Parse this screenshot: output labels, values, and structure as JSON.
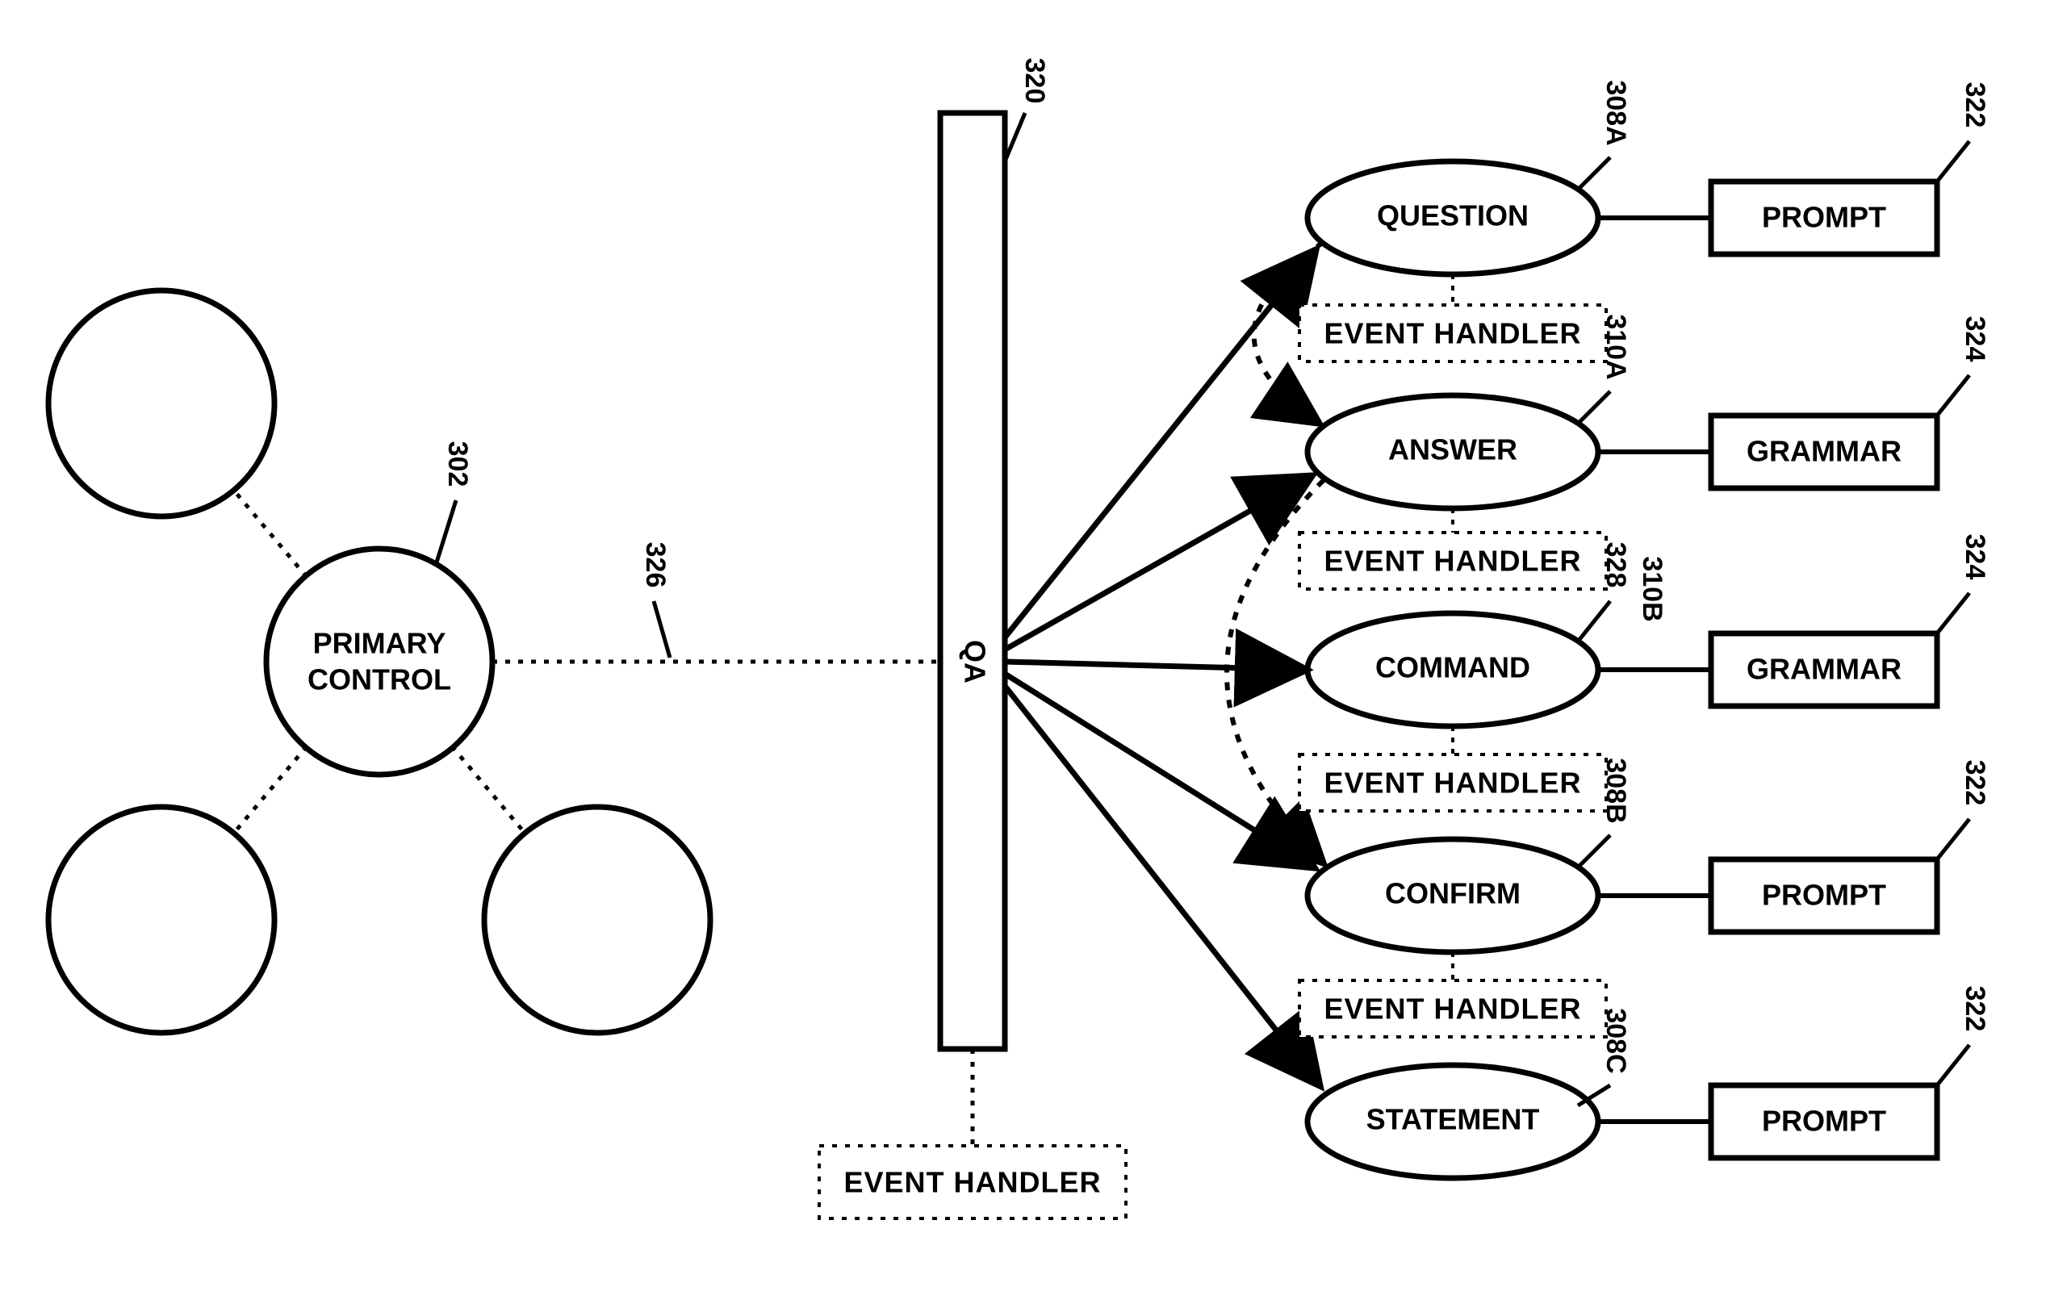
{
  "primary_control": {
    "line1": "PRIMARY",
    "line2": "CONTROL"
  },
  "qa": "QA",
  "event_handler": "EVENT HANDLER",
  "ellipses": {
    "question": "QUESTION",
    "answer": "ANSWER",
    "command": "COMMAND",
    "confirm": "CONFIRM",
    "statement": "STATEMENT"
  },
  "boxes": {
    "prompt": "PROMPT",
    "grammar": "GRAMMAR"
  },
  "refs": {
    "r302": "302",
    "r320": "320",
    "r326": "326",
    "r308A": "308A",
    "r310A": "310A",
    "r328": "328",
    "r310B": "310B",
    "r308B": "308B",
    "r308C": "308C",
    "r322": "322",
    "r324": "324"
  }
}
